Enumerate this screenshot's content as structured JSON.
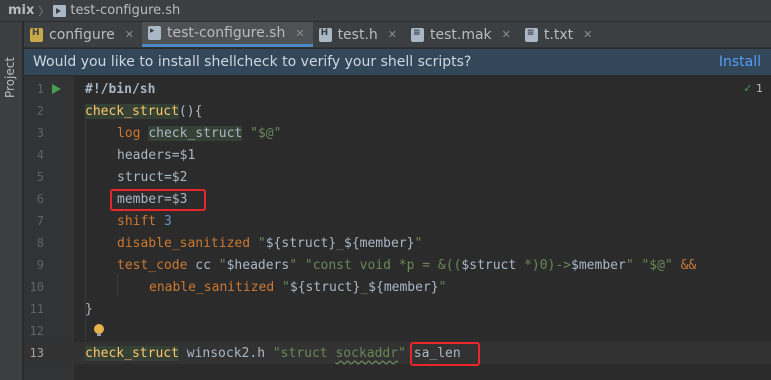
{
  "breadcrumb": {
    "project": "mix",
    "file": "test-configure.sh"
  },
  "sidebar": {
    "label": "Project"
  },
  "tabs": [
    {
      "label": "configure",
      "icon": "header-file-icon",
      "active": false
    },
    {
      "label": "test-configure.sh",
      "icon": "shell-script-icon",
      "active": true
    },
    {
      "label": "test.h",
      "icon": "header-file-icon",
      "active": false
    },
    {
      "label": "test.mak",
      "icon": "makefile-icon",
      "active": false
    },
    {
      "label": "t.txt",
      "icon": "text-file-icon",
      "active": false
    }
  ],
  "banner": {
    "message": "Would you like to install shellcheck to verify your shell scripts?",
    "action": "Install"
  },
  "inspection": {
    "count": "1"
  },
  "code": {
    "line_numbers": [
      "1",
      "2",
      "3",
      "4",
      "5",
      "6",
      "7",
      "8",
      "9",
      "10",
      "11",
      "12",
      "13"
    ],
    "l1": "#!/bin/sh",
    "l2_fn": "check_struct",
    "l2_rest": "(){",
    "l3_cmd": "log",
    "l3_arg": "check_struct",
    "l3_str": "\"$@\"",
    "l4": "headers=$1",
    "l5": "struct=$2",
    "l6": "member=$3",
    "l7_cmd": "shift",
    "l7_num": "3",
    "l8_cmd": "disable_sanitized",
    "l8_q1": "\"",
    "l8_v1": "${struct}",
    "l8_mid": "_",
    "l8_v2": "${member}",
    "l8_q2": "\"",
    "l9_cmd": "test_code",
    "l9_cc": " cc ",
    "l9_q1": "\"",
    "l9_v1": "$headers",
    "l9_q2": "\"",
    "l9_s2": " \"const void *p = &((",
    "l9_v2": "$struct",
    "l9_s3": " *)0)->",
    "l9_v3": "$member",
    "l9_s4": "\" ",
    "l9_s5": "\"$@\"",
    "l9_and": " &&",
    "l10_cmd": "enable_sanitized",
    "l10_q1": " \"",
    "l10_v1": "${struct}",
    "l10_mid": "_",
    "l10_v2": "${member}",
    "l10_q2": "\"",
    "l11": "}",
    "l13_fn": "check_struct",
    "l13_arg1": " winsock2.h ",
    "l13_str_a": "\"struct ",
    "l13_str_b": "sockaddr",
    "l13_str_c": "\"",
    "l13_arg2": "sa_len"
  }
}
